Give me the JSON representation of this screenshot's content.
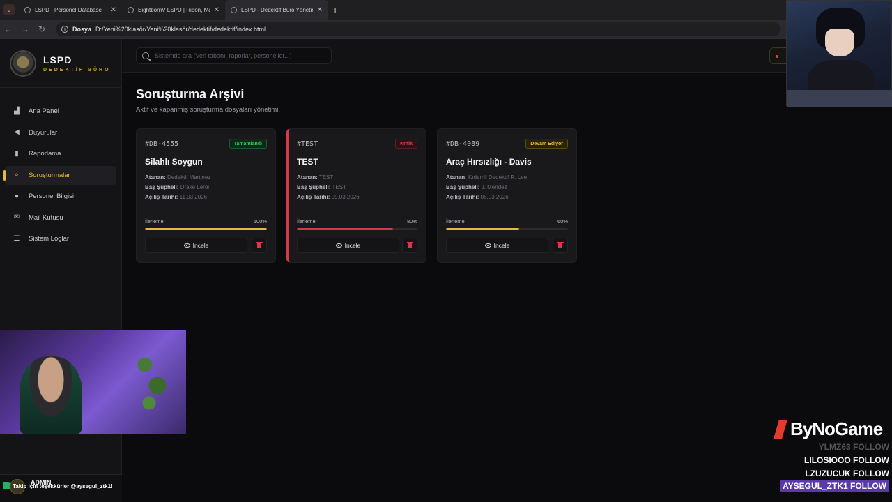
{
  "browser": {
    "tabs": [
      {
        "title": "LSPD - Personel Database"
      },
      {
        "title": "EightbornV LSPD | Ribon, Madi"
      },
      {
        "title": "LSPD - Dedektif Büro Yönetim P"
      }
    ],
    "url_chip": "Dosya",
    "url": "D:/Yeni%20klasör/Yeni%20klasör/dedektif/dedektif/index.html"
  },
  "sidebar": {
    "brand_title": "LSPD",
    "brand_subtitle": "DEDEKTİF BÜRO",
    "items": [
      {
        "label": "Ana Panel",
        "icon": "chart-icon"
      },
      {
        "label": "Duyurular",
        "icon": "megaphone-icon"
      },
      {
        "label": "Raporlama",
        "icon": "file-icon"
      },
      {
        "label": "Soruşturmalar",
        "icon": "search-icon",
        "active": true
      },
      {
        "label": "Personel Bilgisi",
        "icon": "users-icon"
      },
      {
        "label": "Mail Kutusu",
        "icon": "envelope-icon"
      },
      {
        "label": "Sistem Logları",
        "icon": "database-icon"
      }
    ],
    "user_name": "ADMIN"
  },
  "topbar": {
    "search_placeholder": "Sistemde ara (Veri tabanı, raporlar, personeller...)"
  },
  "main": {
    "title": "Soruşturma Arşivi",
    "subtitle": "Aktif ve kapanmış soruşturma dosyaları yönetimi.",
    "labels": {
      "assigned": "Atanan:",
      "suspect": "Baş Şüpheli:",
      "opened": "Açılış Tarihi:",
      "progress": "İlerleme",
      "view": "İncele"
    },
    "cases": [
      {
        "id": "#DB-4555",
        "status": "Tamamlandı",
        "status_kind": "done",
        "title": "Silahlı Soygun",
        "assigned": "Dedektif Martinez",
        "suspect": "Drake Leroi",
        "opened": "11.03.2026",
        "progress": 100,
        "progress_text": "100%",
        "bar_color": "#e7b93a"
      },
      {
        "id": "#TEST",
        "status": "Kritik",
        "status_kind": "crit",
        "title": "TEST",
        "assigned": "TEST",
        "suspect": "TEST",
        "opened": "09.03.2026",
        "progress": 80,
        "progress_text": "80%",
        "bar_color": "#d6394a"
      },
      {
        "id": "#DB-4089",
        "status": "Devam Ediyor",
        "status_kind": "prog",
        "title": "Araç Hırsızlığı - Davis",
        "assigned": "Kıdemli Dedektif R. Lee",
        "suspect": "J. Mendez",
        "opened": "05.03.2026",
        "progress": 60,
        "progress_text": "60%",
        "bar_color": "#e7b93a"
      }
    ]
  },
  "overlay": {
    "brand": "ByNoGame",
    "follows": [
      {
        "text": "YLMZ63  FOLLOW",
        "style": "dim"
      },
      {
        "text": "LILOSIOOO  FOLLOW",
        "style": "normal"
      },
      {
        "text": "LZUZUCUK  FOLLOW",
        "style": "normal"
      },
      {
        "text": "AYSEGUL_ZTK1  FOLLOW",
        "style": "hl"
      }
    ],
    "chat": "Takip için teşekkürler @aysegul_ztk1!"
  }
}
